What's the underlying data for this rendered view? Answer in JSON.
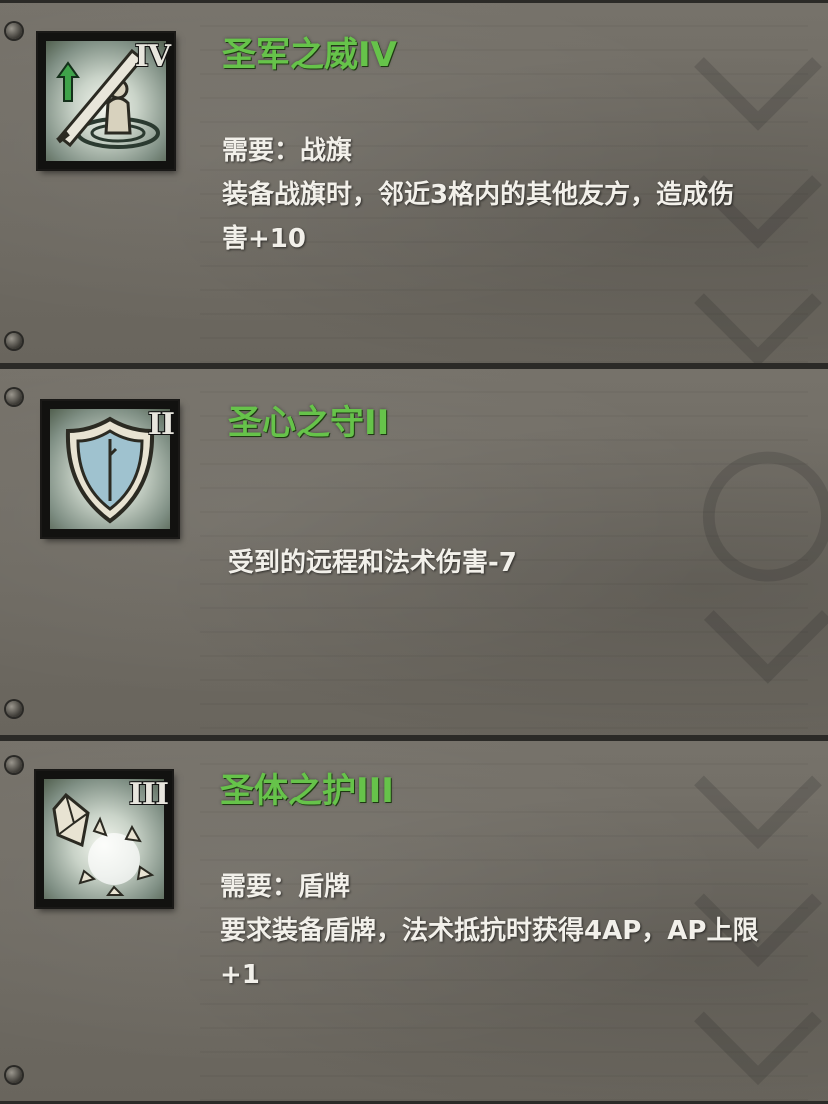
{
  "skills": [
    {
      "title": "圣军之威IV",
      "rank": "IV",
      "icon": "banner-aura-icon",
      "requirement": "需要：战旗",
      "desc_line1": "装备战旗时，邻近3格内的其他友方，造成伤",
      "desc_line2": "害+10"
    },
    {
      "title": "圣心之守II",
      "rank": "II",
      "icon": "shield-icon",
      "desc_line1": "受到的远程和法术伤害-7"
    },
    {
      "title": "圣体之护III",
      "rank": "III",
      "icon": "shattered-crystal-icon",
      "requirement": "需要：盾牌",
      "desc_line1": "要求装备盾牌，法术抵抗时获得4AP，AP上限",
      "desc_line2": "+1"
    }
  ],
  "colors": {
    "title_green": "#66c34a",
    "body_text": "#f2f0ea",
    "parchment": "#6f6b63"
  }
}
